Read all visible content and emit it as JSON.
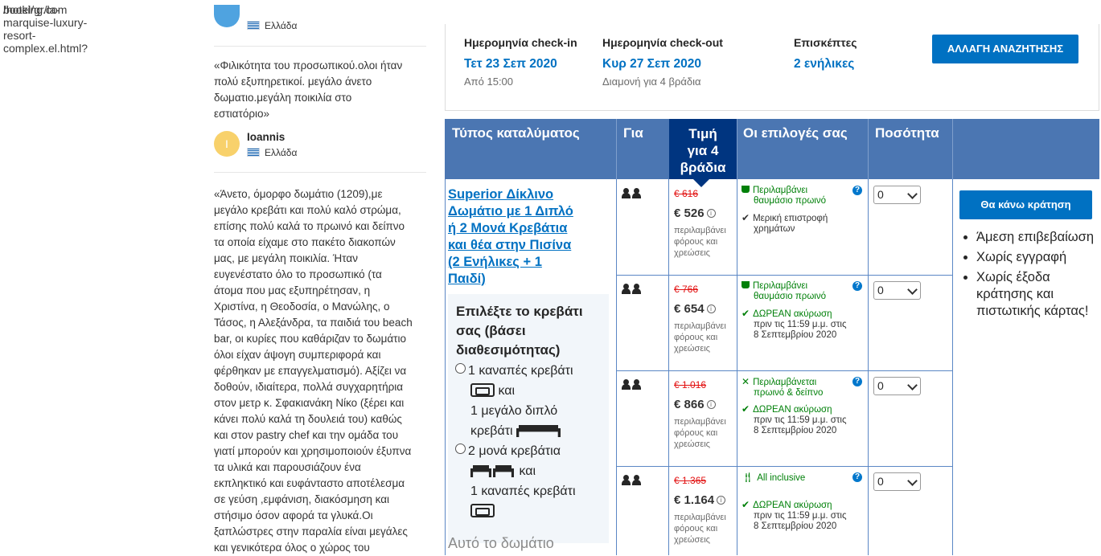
{
  "browser": {
    "url_host": "booking.com",
    "url_path": "/hotel/gr/la-marquise-luxury-resort-complex.el.html?"
  },
  "reviews": {
    "top_country": "Ελλάδα",
    "review1_text": "«Φιλικότητα του προσωπικού.ολοι ήταν πολύ εξυπηρετικοί. μεγάλο άνετο δωματιο.μεγάλη ποικιλία στο εστιατόριο»",
    "review1_line1": "«Φιλικότητα του προσωπικού.ολοι ήταν",
    "review1_line2": "πολύ εξυπηρετικοί. μεγάλο άνετο",
    "review1_line3": "δωματιο.μεγάλη ποικιλία στο",
    "review1_line4": "εστιατόριο»",
    "reviewer2_initial": "I",
    "reviewer2_name": "Ioannis",
    "reviewer2_country": "Ελλάδα",
    "review2_lines": [
      "«Άνετο, όμορφο δωμάτιο (1209),με",
      "μεγάλο κρεβάτι και πολύ καλό στρώμα,",
      "επίσης πολύ καλά το πρωινό και δείπνο",
      "τα οποία είχαμε στο πακέτο διακοπών",
      "μας, με μεγάλη ποικιλία. Ήταν",
      "ευγενέστατο όλο το προσωπικό (τα",
      "άτομα που μας εξυπηρέτησαν, η",
      "Χριστίνα, η Θεοδοσία, ο Μανώλης, ο",
      "Τάσος, η Αλεξάνδρα, τα παιδιά του beach",
      "bar, οι κυρίες που καθάριζαν το δωμάτιο",
      "όλοι είχαν άψογη συμπεριφορά και",
      "φέρθηκαν με επαγγελματισμό). Αξίζει να",
      "δοθούν, ιδιαίτερα, πολλά συγχαρητήρια",
      "στον μετρ κ. Σφακιανάκη Νίκο (ξέρει και",
      "κάνει πολύ καλά τη δουλειά του) καθώς",
      "και στον pastry chef και την ομάδα του",
      "γιατί μπορούν και χρησιμοποιούν έξυπνα",
      "τα υλικά και παρουσιάζουν ένα",
      "εκπληκτικό και ευφάνταστο αποτέλεσμα",
      "σε γεύση ,εμφάνιση, διακόσμηση και",
      "στήσιμο όσον αφορά τα γλυκά.Οι",
      "ξαπλώστρες στην παραλία είναι μεγάλες",
      "και γενικότερα όλος ο χώρος του"
    ]
  },
  "search": {
    "checkin_label": "Ημερομηνία check-in",
    "checkin_value": "Τετ 23 Σεπ 2020",
    "checkin_sub": "Από 15:00",
    "checkout_label": "Ημερομηνία check-out",
    "checkout_value": "Κυρ 27 Σεπ 2020",
    "checkout_sub": "Διαμονή για 4 βράδια",
    "guests_label": "Επισκέπτες",
    "guests_value": "2 ενήλικες",
    "change_button": "ΑΛΛΑΓΗ ΑΝΑΖΗΤΗΣΗΣ"
  },
  "table": {
    "col_room_type": "Τύπος καταλύματος",
    "col_for": "Για",
    "col_price_l1": "Τιμή",
    "col_price_l2": "για 4",
    "col_price_l3": "βράδια",
    "col_options": "Οι επιλογές σας",
    "col_quantity": "Ποσότητα"
  },
  "room": {
    "name_lines": [
      "Superior Δίκλινο",
      "Δωμάτιο με 1 Διπλό",
      "ή 2 Μονά Κρεβάτια",
      "και θέα στην Πισίνα",
      "(2 Ενήλικες + 1",
      "Παιδί)"
    ],
    "bed_title_lines": [
      "Επιλέξτε το κρεβάτι",
      "σας (βάσει",
      "διαθεσιμότητας)"
    ],
    "bed_option1_a": "1 καναπές κρεβάτι",
    "bed_option1_and": "και",
    "bed_option1_b1": "1 μεγάλο διπλό",
    "bed_option1_b2": "κρεβάτι",
    "bed_option2_a": "2 μονά κρεβάτια",
    "bed_option2_and": "και",
    "bed_option2_b": "1 καναπές κρεβάτι",
    "footer_text": "Αυτό το δωμάτιο"
  },
  "rates": [
    {
      "old_price": "€ 616",
      "price": "€ 526",
      "tax_lines": [
        "περιλαμβάνει",
        "φόρους και",
        "χρεώσεις"
      ],
      "meal_lines": [
        "Περιλαμβάνει",
        "θαυμάσιο πρωινό"
      ],
      "cancel_lines": [
        "Μερική επιστροφή",
        "χρημάτων"
      ],
      "qty": "0"
    },
    {
      "old_price": "€ 766",
      "price": "€ 654",
      "tax_lines": [
        "περιλαμβάνει",
        "φόρους και",
        "χρεώσεις"
      ],
      "meal_lines": [
        "Περιλαμβάνει",
        "θαυμάσιο πρωινό"
      ],
      "cancel_lines": [
        "ΔΩΡΕΑΝ ακύρωση",
        "πριν τις 11:59 μ.μ. στις",
        "8 Σεπτεμβρίου 2020"
      ],
      "qty": "0"
    },
    {
      "old_price": "€ 1.016",
      "price": "€ 866",
      "tax_lines": [
        "περιλαμβάνει",
        "φόρους και",
        "χρεώσεις"
      ],
      "meal_lines": [
        "Περιλαμβάνεται",
        "πρωινό & δείπνο"
      ],
      "cancel_lines": [
        "ΔΩΡΕΑΝ ακύρωση",
        "πριν τις 11:59 μ.μ. στις",
        "8 Σεπτεμβρίου 2020"
      ],
      "qty": "0"
    },
    {
      "old_price": "€ 1.365",
      "price": "€ 1.164",
      "tax_lines": [
        "περιλαμβάνει",
        "φόρους και",
        "χρεώσεις"
      ],
      "meal_lines": [
        "All inclusive"
      ],
      "cancel_lines": [
        "ΔΩΡΕΑΝ ακύρωση",
        "πριν τις 11:59 μ.μ. στις",
        "8 Σεπτεμβρίου 2020"
      ],
      "qty": "0"
    }
  ],
  "booking": {
    "button": "Θα κάνω κράτηση",
    "benefits": [
      "Άμεση επιβεβαίωση",
      "Χωρίς εγγραφή",
      "Χωρίς έξοδα κράτησης και πιστωτικής κάρτας!"
    ]
  },
  "icons": {
    "info": "i",
    "help": "?"
  }
}
